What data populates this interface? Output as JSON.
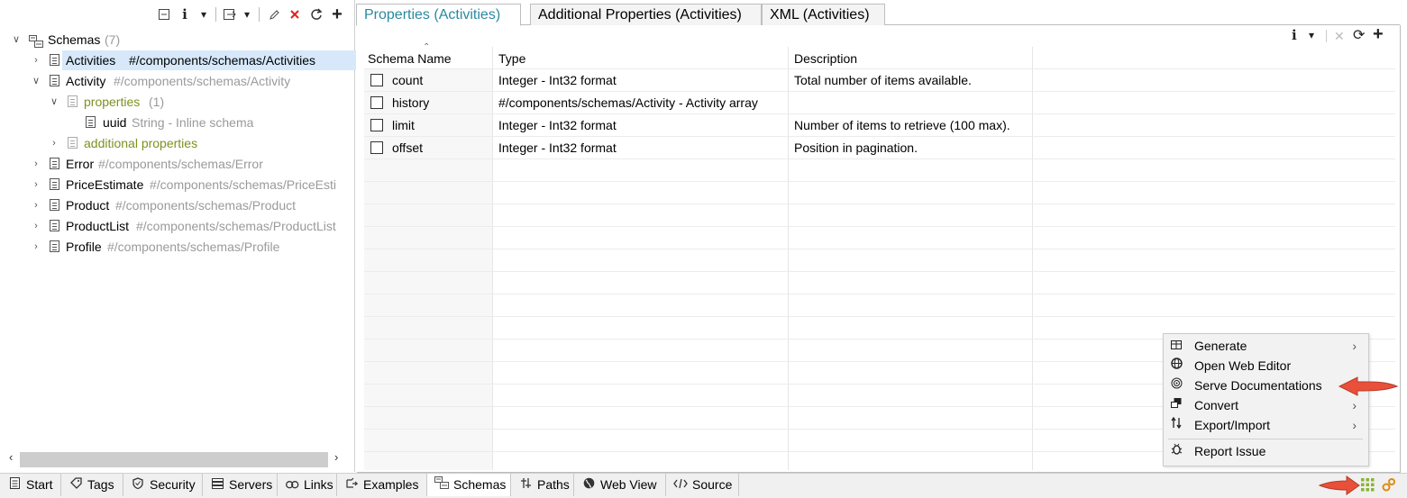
{
  "left_toolbar": {
    "collapse_icon": "collapse-all-icon",
    "info_label": "i",
    "dropdown_label": "▾",
    "import_icon": "import-icon",
    "edit_icon": "pencil-icon",
    "delete_icon": "delete-x-icon",
    "refresh_icon": "refresh-icon",
    "add_label": "+"
  },
  "tree": {
    "root": {
      "label": "Schemas",
      "count": "(7)"
    },
    "items": [
      {
        "name": "Activities",
        "ref": "#/components/schemas/Activities",
        "selected": true
      },
      {
        "name": "Activity",
        "ref": "#/components/schemas/Activity"
      },
      {
        "name": "properties",
        "ref": "(1)"
      },
      {
        "name": "uuid",
        "ref": "String - Inline schema"
      },
      {
        "name": "additional properties",
        "ref": ""
      },
      {
        "name": "Error",
        "ref": "#/components/schemas/Error"
      },
      {
        "name": "PriceEstimate",
        "ref": "#/components/schemas/PriceEsti"
      },
      {
        "name": "Product",
        "ref": "#/components/schemas/Product"
      },
      {
        "name": "ProductList",
        "ref": "#/components/schemas/ProductList"
      },
      {
        "name": "Profile",
        "ref": "#/components/schemas/Profile"
      }
    ]
  },
  "tabs": [
    {
      "label": "Properties (Activities)",
      "active": true
    },
    {
      "label": "Additional Properties (Activities)"
    },
    {
      "label": "XML (Activities)"
    }
  ],
  "right_toolbar": {
    "info_label": "i",
    "dropdown_label": "▾",
    "close_label": "✕",
    "refresh_label": "⟳",
    "add_label": "+"
  },
  "table": {
    "columns": [
      "Schema Name",
      "Type",
      "Description"
    ],
    "rows": [
      {
        "name": "count",
        "type": "Integer - Int32 format",
        "description": "Total number of items available."
      },
      {
        "name": "history",
        "type": "#/components/schemas/Activity - Activity array",
        "description": ""
      },
      {
        "name": "limit",
        "type": "Integer - Int32 format",
        "description": "Number of items to retrieve (100 max)."
      },
      {
        "name": "offset",
        "type": "Integer - Int32 format",
        "description": "Position in pagination."
      }
    ]
  },
  "context_menu": {
    "items": [
      {
        "label": "Generate",
        "icon": "generate-icon",
        "submenu": true
      },
      {
        "label": "Open Web Editor",
        "icon": "globe-icon"
      },
      {
        "label": "Serve Documentations",
        "icon": "serve-icon"
      },
      {
        "label": "Convert",
        "icon": "convert-icon",
        "submenu": true
      },
      {
        "label": "Export/Import",
        "icon": "export-import-icon",
        "submenu": true
      },
      {
        "label": "Report Issue",
        "icon": "bug-icon"
      }
    ]
  },
  "bottom_tabs": [
    {
      "label": "Start",
      "icon": "document-icon"
    },
    {
      "label": "Tags",
      "icon": "tag-icon"
    },
    {
      "label": "Security",
      "icon": "shield-icon"
    },
    {
      "label": "Servers",
      "icon": "server-icon"
    },
    {
      "label": "Links",
      "icon": "link-icon"
    },
    {
      "label": "Examples",
      "icon": "examples-icon"
    },
    {
      "label": "Schemas",
      "icon": "schemas-icon",
      "active": true
    },
    {
      "label": "Paths",
      "icon": "paths-icon"
    },
    {
      "label": "Web View",
      "icon": "web-icon"
    },
    {
      "label": "Source",
      "icon": "code-icon"
    }
  ],
  "status_icons": [
    "grid-apps-icon",
    "gears-icon"
  ],
  "colors": {
    "accent": "#2a8a9f",
    "olive": "#7f8f1f",
    "arrow": "#e8503a",
    "selection": "#d6e8fa"
  }
}
